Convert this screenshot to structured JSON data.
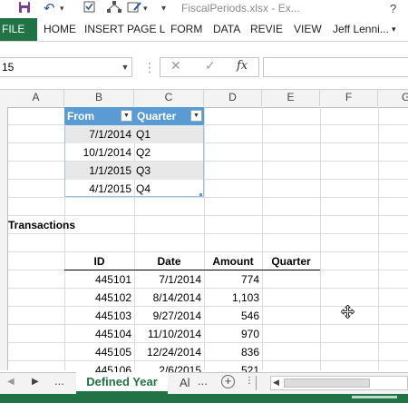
{
  "titlebar": {
    "doc_title": "FiscalPeriods.xlsx - Ex..."
  },
  "ribbon": {
    "file_label": "FILE",
    "tabs": [
      "HOME",
      "INSERT",
      "PAGE L",
      "FORM",
      "DATA",
      "REVIE",
      "VIEW"
    ],
    "user": "Jeff Lenni..."
  },
  "formula_bar": {
    "name_box": "15",
    "fx_label": "fx",
    "cancel_symbol": "✕",
    "enter_symbol": "✓"
  },
  "columns": [
    "A",
    "B",
    "C",
    "D",
    "E",
    "F",
    "G"
  ],
  "lookup_table": {
    "headers": [
      "From",
      "Quarter"
    ],
    "rows": [
      {
        "from": "7/1/2014",
        "quarter": "Q1"
      },
      {
        "from": "10/1/2014",
        "quarter": "Q2"
      },
      {
        "from": "1/1/2015",
        "quarter": "Q3"
      },
      {
        "from": "4/1/2015",
        "quarter": "Q4"
      }
    ]
  },
  "transactions": {
    "title": "Transactions",
    "headers": [
      "ID",
      "Date",
      "Amount",
      "Quarter"
    ],
    "rows": [
      {
        "id": "445101",
        "date": "7/1/2014",
        "amount": "774"
      },
      {
        "id": "445102",
        "date": "8/14/2014",
        "amount": "1,103"
      },
      {
        "id": "445103",
        "date": "9/27/2014",
        "amount": "546"
      },
      {
        "id": "445104",
        "date": "11/10/2014",
        "amount": "970"
      },
      {
        "id": "445105",
        "date": "12/24/2014",
        "amount": "836"
      },
      {
        "id": "445106",
        "date": "2/6/2015",
        "amount": "521"
      }
    ]
  },
  "sheet_tabs": {
    "ellipsis": "...",
    "active": "Defined Year",
    "next": "Al",
    "more": "..."
  },
  "colors": {
    "excel_green": "#217346",
    "table_header": "#5b9bd5"
  }
}
